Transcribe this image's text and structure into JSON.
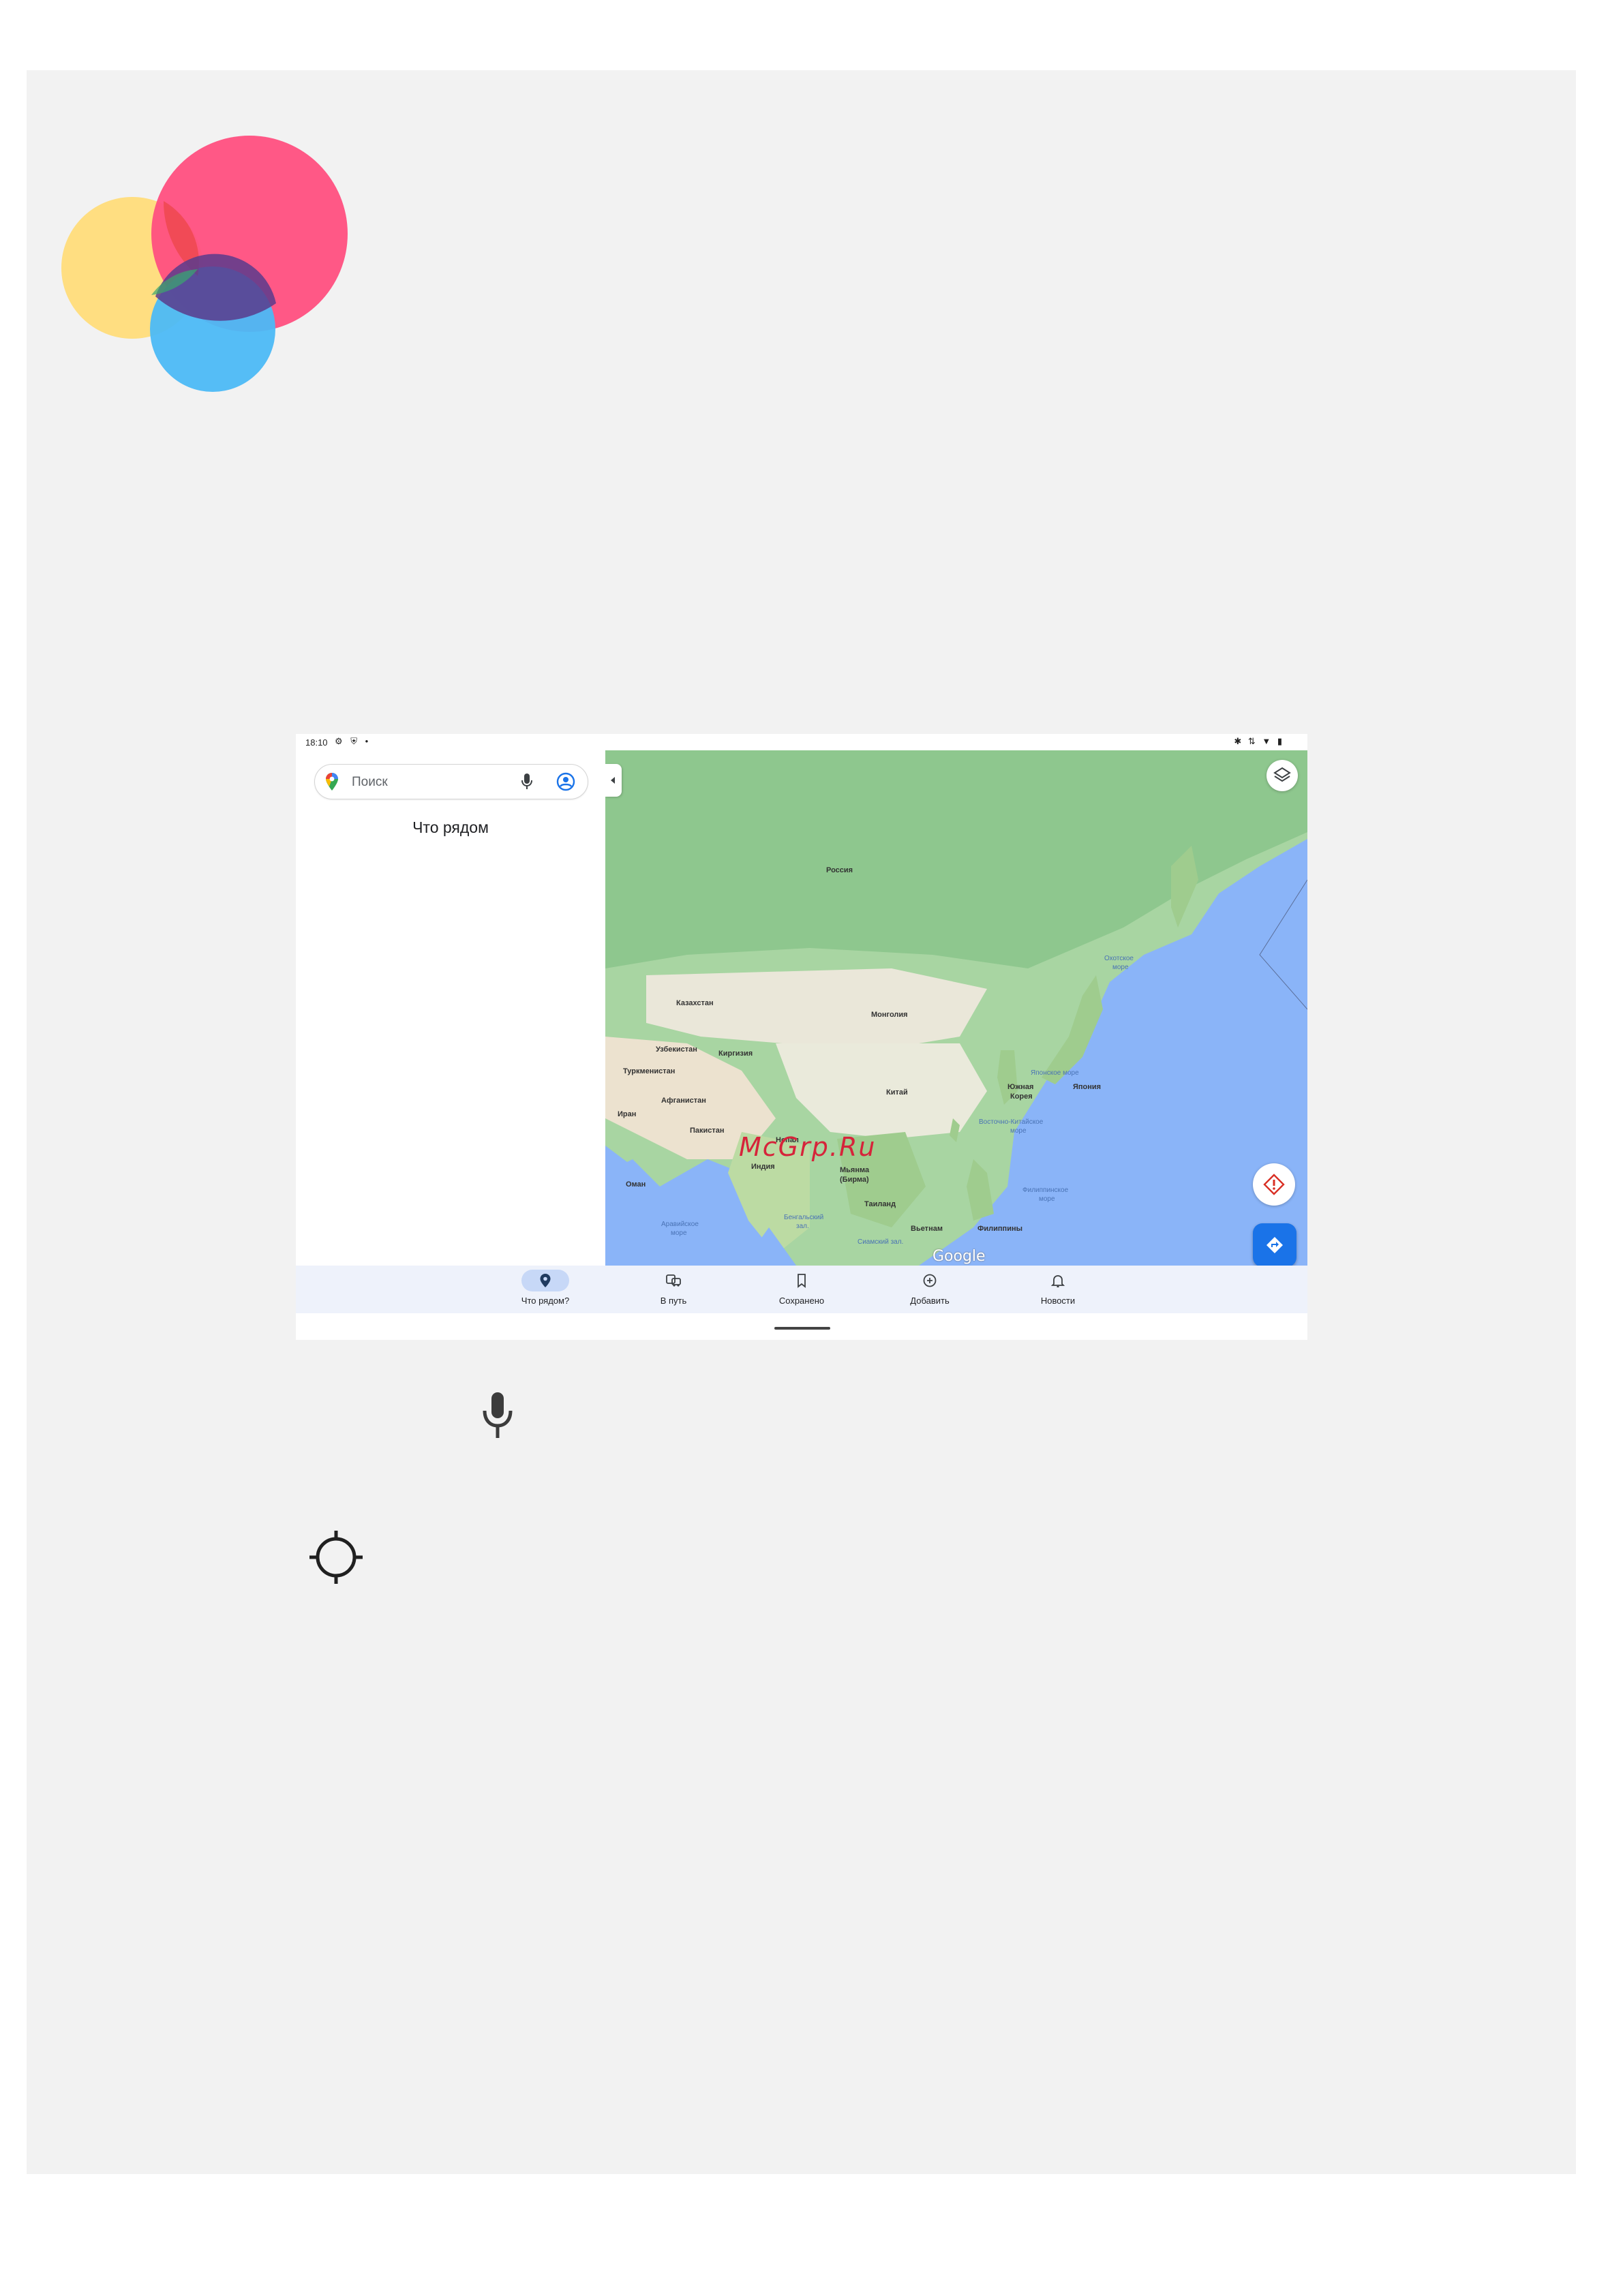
{
  "status_bar": {
    "time": "18:10",
    "left_icons": "⚙ ⛨ •",
    "right_icons": "✱ ⇅ ▼ ▮"
  },
  "search": {
    "placeholder": "Поиск",
    "icons": [
      "maps-pin-icon",
      "mic-icon",
      "account-icon"
    ]
  },
  "left_panel": {
    "title": "Что рядом"
  },
  "map": {
    "labels": {
      "russia": "Россия",
      "kazakhstan": "Казахстан",
      "mongolia": "Монголия",
      "uzbekistan": "Узбекистан",
      "kyrgyzstan": "Киргизия",
      "turkmenistan": "Туркменистан",
      "china": "Китай",
      "south_korea_1": "Южная",
      "south_korea_2": "Корея",
      "japan": "Япония",
      "afghanistan": "Афганистан",
      "iran": "Иран",
      "pakistan": "Пакистан",
      "nepal": "Непал",
      "india": "Индия",
      "oman": "Оман",
      "myanmar_1": "Мьянма",
      "myanmar_2": "(Бирма)",
      "thailand": "Таиланд",
      "vietnam": "Вьетнам",
      "philippines": "Филиппины",
      "okhotsk_sea_1": "Охотское",
      "okhotsk_sea_2": "море",
      "japan_sea": "Японское море",
      "east_china_sea_1": "Восточно-Китайское",
      "east_china_sea_2": "море",
      "philippine_sea_1": "Филиппинское",
      "philippine_sea_2": "море",
      "arabian_sea_1": "Аравийское",
      "arabian_sea_2": "море",
      "bengal_bay_1": "Бенгальский",
      "bengal_bay_2": "зал.",
      "siam_gulf": "Сиамский зал."
    },
    "watermark": "McGrp.Ru",
    "brand": "Google",
    "icons": [
      "collapse-icon",
      "layers-icon",
      "my-location-icon",
      "directions-icon"
    ]
  },
  "bottom_nav": {
    "items": [
      {
        "label": "Что рядом?",
        "icon": "explore-pin-icon",
        "active": true
      },
      {
        "label": "В путь",
        "icon": "commute-icon",
        "active": false
      },
      {
        "label": "Сохранено",
        "icon": "bookmark-icon",
        "active": false
      },
      {
        "label": "Добавить",
        "icon": "add-circle-icon",
        "active": false
      },
      {
        "label": "Новости",
        "icon": "bell-icon",
        "active": false
      }
    ]
  },
  "document": {
    "icons": [
      "logo-circles-icon",
      "mic-icon",
      "crosshair-icon"
    ],
    "colors": {
      "logo_yellow": "#ffdc7a",
      "logo_pink": "#ff4f7f",
      "logo_blue": "#4cb9f5",
      "accent_blue": "#1a73e8"
    }
  }
}
